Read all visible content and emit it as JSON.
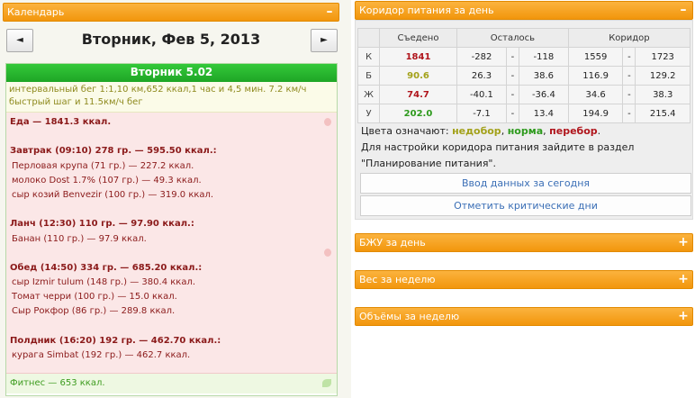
{
  "calendar": {
    "header_title": "Календарь",
    "toggle": "–",
    "prev_arrow": "◄",
    "next_arrow": "►",
    "date_title": "Вторник, Фев 5, 2013",
    "day_label": "Вторник 5.02",
    "workout_lines": [
      "интервальный бег 1:1,10 км,652 ккал,1 час и 4,5 мин. 7.2 км/ч",
      "быстрый шаг и 11.5км/ч бег"
    ],
    "food_lines": [
      {
        "text": "Еда — 1841.3 ккал.",
        "bold": true
      },
      {
        "text": "",
        "bold": false
      },
      {
        "text": "Завтрак (09:10) 278 гр. — 595.50 ккал.:",
        "bold": true
      },
      {
        "text": "Перловая крупа (71 гр.) — 227.2 ккал.",
        "bold": false
      },
      {
        "text": "молоко Dost 1.7% (107 гр.) — 49.3 ккал.",
        "bold": false
      },
      {
        "text": "сыр козий Benvezir (100 гр.) — 319.0 ккал.",
        "bold": false
      },
      {
        "text": "",
        "bold": false
      },
      {
        "text": "Ланч (12:30) 110 гр. — 97.90 ккал.:",
        "bold": true
      },
      {
        "text": "Банан (110 гр.) — 97.9 ккал.",
        "bold": false
      },
      {
        "text": "",
        "bold": false
      },
      {
        "text": "Обед (14:50) 334 гр. — 685.20 ккал.:",
        "bold": true
      },
      {
        "text": "сыр Izmir tulum (148 гр.) — 380.4 ккал.",
        "bold": false
      },
      {
        "text": "Томат черри (100 гр.) — 15.0 ккал.",
        "bold": false
      },
      {
        "text": "Сыр Рокфор (86 гр.) — 289.8 ккал.",
        "bold": false
      },
      {
        "text": "",
        "bold": false
      },
      {
        "text": "Полдник (16:20) 192 гр. — 462.70 ккал.:",
        "bold": true
      },
      {
        "text": "курага Simbat (192 гр.) — 462.7 ккал.",
        "bold": false
      }
    ],
    "fitness": "Фитнес — 653 ккал."
  },
  "corridor": {
    "header_title": "Коридор питания за день",
    "toggle": "–",
    "columns": [
      "Съедено",
      "Осталось",
      "Коридор"
    ],
    "rows": [
      {
        "label": "К",
        "eaten": "1841",
        "eaten_color": "#b0151c",
        "rem_from": "-282",
        "rem_to": "-118",
        "cor_from": "1559",
        "cor_to": "1723"
      },
      {
        "label": "Б",
        "eaten": "90.6",
        "eaten_color": "#a3a11a",
        "rem_from": "26.3",
        "rem_to": "38.6",
        "cor_from": "116.9",
        "cor_to": "129.2"
      },
      {
        "label": "Ж",
        "eaten": "74.7",
        "eaten_color": "#b0151c",
        "rem_from": "-40.1",
        "rem_to": "-36.4",
        "cor_from": "34.6",
        "cor_to": "38.3"
      },
      {
        "label": "У",
        "eaten": "202.0",
        "eaten_color": "#2e9a1d",
        "rem_from": "-7.1",
        "rem_to": "13.4",
        "cor_from": "194.9",
        "cor_to": "215.4"
      }
    ],
    "dash": "-",
    "legend_prefix": "Цвета означают:",
    "legend_under": "недобор",
    "legend_under_color": "#a3a11a",
    "legend_norm": "норма",
    "legend_norm_color": "#2e9a1d",
    "legend_over": "перебор",
    "legend_over_color": "#b0151c",
    "settings_line1": "Для настройки коридора питания зайдите в раздел",
    "settings_line2": "\"Планирование питания\".",
    "btn_enter": "Ввод данных за сегодня",
    "btn_critical": "Отметить критические дни"
  },
  "panels": [
    {
      "title": "БЖУ за день",
      "toggle": "+"
    },
    {
      "title": "Вес за неделю",
      "toggle": "+"
    },
    {
      "title": "Объёмы за неделю",
      "toggle": "+"
    }
  ],
  "colors": {
    "header_orange": "#f7a523",
    "day_green": "#2bb631",
    "food_text": "#8b1a1a",
    "link_blue": "#3b6fb6"
  }
}
